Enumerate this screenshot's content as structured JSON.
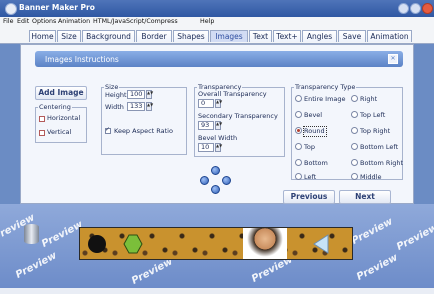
{
  "window": {
    "title": "Banner Maker Pro"
  },
  "menu": [
    "File",
    "Edit",
    "Options",
    "Animation",
    "HTML/JavaScript/Compress",
    "Help"
  ],
  "tabs": [
    "Home",
    "Size",
    "Background",
    "Border",
    "Shapes",
    "Images",
    "Text",
    "Text+",
    "Angles",
    "Save",
    "Animation"
  ],
  "active_tab": "Images",
  "panel": {
    "instructions_label": "Images Instructions",
    "add_image_label": "Add Image",
    "centering": {
      "label": "Centering",
      "horizontal": "Horizontal",
      "vertical": "Vertical"
    },
    "size": {
      "label": "Size",
      "height_label": "Height",
      "height_value": "100",
      "width_label": "Width",
      "width_value": "133",
      "keep_aspect": "Keep Aspect Ratio",
      "keep_aspect_checked": true
    },
    "transparency": {
      "label": "Transparency",
      "overall_label": "Overall Transparency",
      "overall_value": "0",
      "secondary_label": "Secondary Transparency",
      "secondary_value": "93",
      "bevel_label": "Bevel Width",
      "bevel_value": "10"
    },
    "transparency_type": {
      "label": "Transparency Type",
      "options": [
        "Entire Image",
        "Right",
        "Bevel",
        "Top Left",
        "Round",
        "Top Right",
        "Top",
        "Bottom Left",
        "Bottom",
        "Bottom Right",
        "Left",
        "Middle"
      ],
      "selected": "Round"
    },
    "previous_label": "Previous",
    "next_label": "Next"
  },
  "preview": {
    "watermark": "Preview"
  },
  "colors": {
    "titlebar": "#2f58a3",
    "tab_active": "#d2dcf4",
    "preview_bg": "#7f9bd3",
    "banner_bg": "#c9922e"
  }
}
